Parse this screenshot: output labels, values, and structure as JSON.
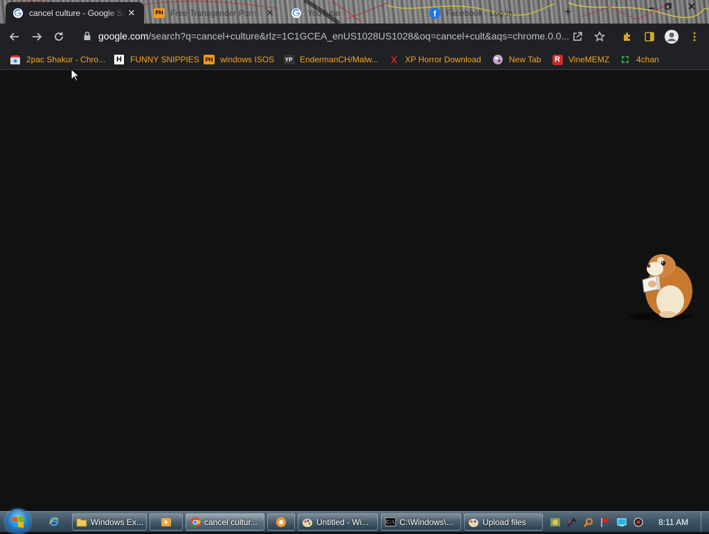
{
  "tabs": [
    {
      "title": "cancel culture - Google Search",
      "icon": "google-icon",
      "active": true
    },
    {
      "title": "Free Transgender Porn Vi",
      "icon": "ph-icon",
      "active": false
    },
    {
      "title": "YouTube",
      "icon": "google-icon",
      "active": false
    },
    {
      "title": "Facebook - Log In",
      "icon": "facebook-icon",
      "active": false
    }
  ],
  "tab_ph_text": "PH",
  "new_tab_symbol": "+",
  "omnibox": {
    "host": "google.com",
    "path": "/search?q=cancel+culture&rlz=1C1GCEA_enUS1028US1028&oq=cancel+cult&aqs=chrome.0.0..."
  },
  "bookmarks": [
    {
      "label": "2pac Shakur - Chro...",
      "icon": "chrome-store-icon"
    },
    {
      "label": "FUNNY SNIPPIES",
      "icon": "h-icon"
    },
    {
      "label": "windows ISOS",
      "icon": "ph-icon"
    },
    {
      "label": "EndermanCH/Malw...",
      "icon": "yp-icon"
    },
    {
      "label": "XP Horror Download",
      "icon": "x-icon"
    },
    {
      "label": "New Tab",
      "icon": "ball-icon"
    },
    {
      "label": "VineMEMZ",
      "icon": "r-icon"
    },
    {
      "label": "4chan",
      "icon": "clover-icon"
    }
  ],
  "bookmark_icon_text": {
    "h": "H",
    "ph": "PH",
    "yp": "YP",
    "x": "X",
    "r": "R"
  },
  "taskbar": {
    "items": [
      {
        "label": "Windows Ex...",
        "icon": "folder-icon",
        "active": false
      },
      {
        "label": "",
        "icon": "media-player-icon",
        "active": false
      },
      {
        "label": "cancel cultur...",
        "icon": "chrome-icon",
        "active": true
      },
      {
        "label": "",
        "icon": "app-icon",
        "active": false
      },
      {
        "label": "Untitled - Wi...",
        "icon": "paint-icon",
        "active": false
      },
      {
        "label": "C:\\Windows\\...",
        "icon": "cmd-icon",
        "active": false
      },
      {
        "label": "Upload files",
        "icon": "upload-icon",
        "active": false
      }
    ],
    "cmd_icon_text": "C:\\",
    "clock": "8:11 AM"
  },
  "colors": {
    "bookmark_text": "#f5a623",
    "toolbar_bg": "#202124",
    "content_bg": "#111111"
  }
}
